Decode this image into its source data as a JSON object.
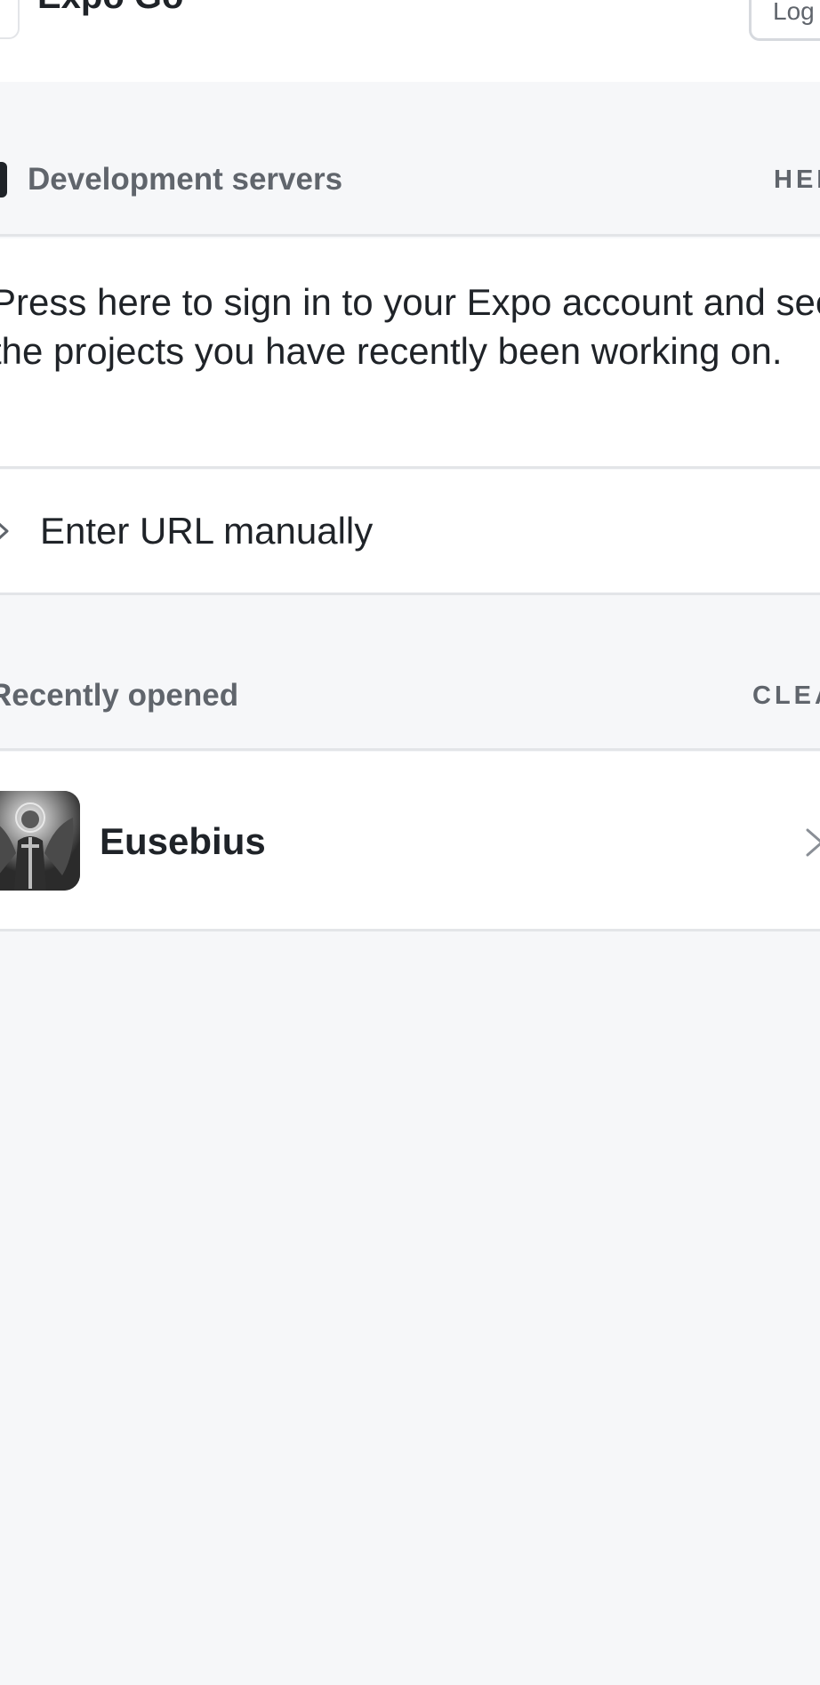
{
  "header": {
    "title": "Expo Go",
    "login_label": "Log In"
  },
  "dev_servers": {
    "title": "Development servers",
    "action": "HELP",
    "signin_text": "Press here to sign in to your Expo account and see the projects you have recently been working on.",
    "enter_url_label": "Enter URL manually"
  },
  "recent": {
    "title": "Recently opened",
    "action": "CLEAR",
    "items": [
      {
        "name": "Eusebius",
        "icon": "eusebius-app-icon"
      }
    ]
  },
  "colors": {
    "background": "#f6f7f9",
    "card": "#ffffff",
    "text": "#1f2328",
    "muted": "#60656c",
    "divider": "#e3e5e8"
  }
}
